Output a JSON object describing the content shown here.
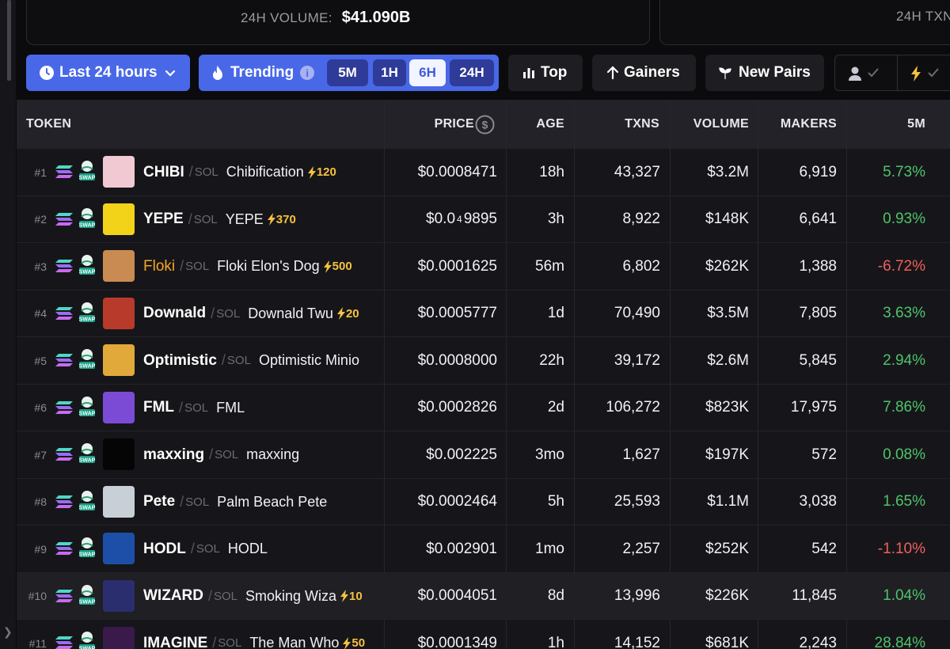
{
  "stats": {
    "volume_label": "24H VOLUME:",
    "volume_value": "$41.090B",
    "txns_label": "24H TXN"
  },
  "toolbar": {
    "timeframe": "Last 24 hours",
    "trending": "Trending",
    "info": "i",
    "segments": [
      "5M",
      "1H",
      "6H",
      "24H"
    ],
    "active_segment": "6H",
    "top": "Top",
    "gainers": "Gainers",
    "new_pairs": "New Pairs"
  },
  "table": {
    "headers": {
      "token": "TOKEN",
      "price": "PRICE",
      "age": "AGE",
      "txns": "TXNS",
      "volume": "VOLUME",
      "makers": "MAKERS",
      "m5": "5M"
    },
    "chain": "SOL",
    "rows": [
      {
        "rank": "#1",
        "symbol": "CHIBI",
        "name": "Chibification",
        "boost": "120",
        "price": "$0.0008471",
        "age": "18h",
        "txns": "43,327",
        "volume": "$3.2M",
        "makers": "6,919",
        "change": "5.73%",
        "dir": "up"
      },
      {
        "rank": "#2",
        "symbol": "YEPE",
        "name": "YEPE",
        "boost": "370",
        "price_prefix": "$0.0",
        "price_sub": "4",
        "price_rest": "9895",
        "age": "3h",
        "txns": "8,922",
        "volume": "$148K",
        "makers": "6,641",
        "change": "0.93%",
        "dir": "up"
      },
      {
        "rank": "#3",
        "symbol": "Floki",
        "name": "Floki Elon's Dog",
        "boost": "500",
        "price": "$0.0001625",
        "age": "56m",
        "txns": "6,802",
        "volume": "$262K",
        "makers": "1,388",
        "change": "-6.72%",
        "dir": "down"
      },
      {
        "rank": "#4",
        "symbol": "Downald",
        "name": "Downald Twu",
        "boost": "20",
        "price": "$0.0005777",
        "age": "1d",
        "txns": "70,490",
        "volume": "$3.5M",
        "makers": "7,805",
        "change": "3.63%",
        "dir": "up"
      },
      {
        "rank": "#5",
        "symbol": "Optimistic",
        "name": "Optimistic Minio",
        "boost": "",
        "price": "$0.0008000",
        "age": "22h",
        "txns": "39,172",
        "volume": "$2.6M",
        "makers": "5,845",
        "change": "2.94%",
        "dir": "up"
      },
      {
        "rank": "#6",
        "symbol": "FML",
        "name": "FML",
        "boost": "",
        "price": "$0.0002826",
        "age": "2d",
        "txns": "106,272",
        "volume": "$823K",
        "makers": "17,975",
        "change": "7.86%",
        "dir": "up"
      },
      {
        "rank": "#7",
        "symbol": "maxxing",
        "name": "maxxing",
        "boost": "",
        "price": "$0.002225",
        "age": "3mo",
        "txns": "1,627",
        "volume": "$197K",
        "makers": "572",
        "change": "0.08%",
        "dir": "up"
      },
      {
        "rank": "#8",
        "symbol": "Pete",
        "name": "Palm Beach Pete",
        "boost": "",
        "price": "$0.0002464",
        "age": "5h",
        "txns": "25,593",
        "volume": "$1.1M",
        "makers": "3,038",
        "change": "1.65%",
        "dir": "up"
      },
      {
        "rank": "#9",
        "symbol": "HODL",
        "name": "HODL",
        "boost": "",
        "price": "$0.002901",
        "age": "1mo",
        "txns": "2,257",
        "volume": "$252K",
        "makers": "542",
        "change": "-1.10%",
        "dir": "down"
      },
      {
        "rank": "#10",
        "symbol": "WIZARD",
        "name": "Smoking Wiza",
        "boost": "10",
        "price": "$0.0004051",
        "age": "8d",
        "txns": "13,996",
        "volume": "$226K",
        "makers": "11,845",
        "change": "1.04%",
        "dir": "up"
      },
      {
        "rank": "#11",
        "symbol": "IMAGINE",
        "name": "The Man Who",
        "boost": "50",
        "price": "$0.0001349",
        "age": "1h",
        "txns": "14,152",
        "volume": "$681K",
        "makers": "2,243",
        "change": "28.84%",
        "dir": "up"
      }
    ]
  },
  "colors": {
    "accent": "#4968e8",
    "positive": "#4fc36b",
    "negative": "#f0605a",
    "boost": "#f6c23e",
    "highlight_symbol": "#f5a524"
  },
  "icons": [
    "clock-icon",
    "chevron-down-icon",
    "flame-icon",
    "info-icon",
    "bar-chart-icon",
    "arrow-up-icon",
    "sprout-icon",
    "user-icon",
    "check-icon",
    "bolt-icon",
    "dollar-circle-icon",
    "solana-icon",
    "swap-badge-icon"
  ]
}
